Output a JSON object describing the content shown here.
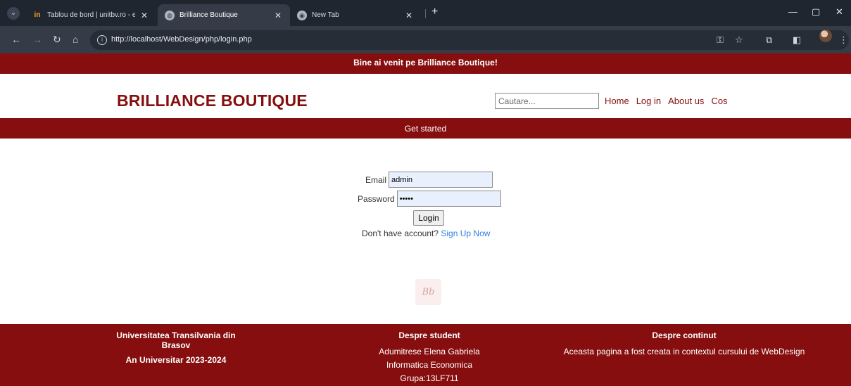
{
  "browser": {
    "tabs": [
      {
        "title": "Tablou de bord | unitbv.ro - e-L",
        "favicon": "in"
      },
      {
        "title": "Brilliance Boutique",
        "favicon": "globe"
      },
      {
        "title": "New Tab",
        "favicon": "chrome"
      }
    ],
    "url": "http://localhost/WebDesign/php/login.php"
  },
  "banner": {
    "text": "Bine ai venit pe Brilliance Boutique!"
  },
  "header": {
    "brand": "BRILLIANCE BOUTIQUE",
    "search_placeholder": "Cautare...",
    "nav": [
      "Home",
      "Log in",
      "About us",
      "Cos"
    ]
  },
  "get_started": {
    "text": "Get started"
  },
  "login_form": {
    "email_label": "Email",
    "email_value": "admin",
    "password_label": "Password",
    "password_value": "•••••",
    "login_button": "Login",
    "signup_prompt": "Don't have account?",
    "signup_link": "Sign Up Now"
  },
  "footer": {
    "col1": {
      "line1": "Universitatea Transilvania din Brasov",
      "line2": "An Universitar 2023-2024"
    },
    "col2": {
      "title": "Despre student",
      "lines": [
        "Adumitrese Elena Gabriela",
        "Informatica Economica",
        "Grupa:13LF711"
      ]
    },
    "col3": {
      "title": "Despre continut",
      "text": "Aceasta pagina a fost creata in contextul cursului de WebDesign"
    }
  },
  "colors": {
    "brand": "#860e0e",
    "link": "#2f7ee0"
  }
}
